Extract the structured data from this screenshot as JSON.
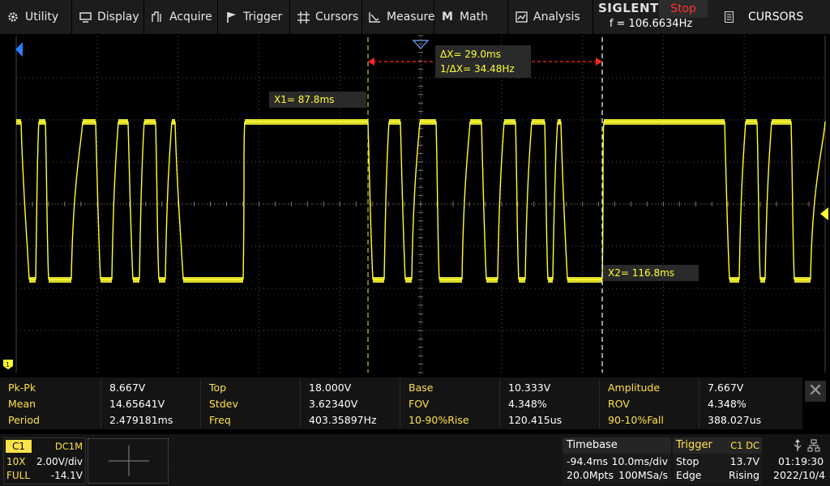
{
  "menu": [
    {
      "label": "Utility",
      "icon": "gear-icon"
    },
    {
      "label": "Display",
      "icon": "monitor-icon"
    },
    {
      "label": "Acquire",
      "icon": "acquire-icon"
    },
    {
      "label": "Trigger",
      "icon": "flag-icon"
    },
    {
      "label": "Cursors",
      "icon": "cursors-icon"
    },
    {
      "label": "Measure",
      "icon": "measure-icon"
    },
    {
      "label": "Math",
      "icon": "math-icon"
    },
    {
      "label": "Analysis",
      "icon": "analysis-icon"
    }
  ],
  "brand": {
    "name": "SIGLENT",
    "status": "Stop",
    "freq": "f = 106.6634Hz"
  },
  "panel": {
    "label": "CURSORS",
    "icon": "document-icon"
  },
  "cursors": {
    "delta_x": "ΔX= 29.0ms",
    "inv_delta_x": "1/ΔX= 34.48Hz",
    "x1": "X1= 87.8ms",
    "x2": "X2= 116.8ms"
  },
  "measure": [
    [
      {
        "label": "Pk-Pk",
        "value": "8.667V"
      },
      {
        "label": "Top",
        "value": "18.000V"
      },
      {
        "label": "Base",
        "value": "10.333V"
      },
      {
        "label": "Amplitude",
        "value": "7.667V"
      }
    ],
    [
      {
        "label": "Mean",
        "value": "14.65641V"
      },
      {
        "label": "Stdev",
        "value": "3.62340V"
      },
      {
        "label": "FOV",
        "value": "4.348%"
      },
      {
        "label": "ROV",
        "value": "4.348%"
      }
    ],
    [
      {
        "label": "Period",
        "value": "2.479181ms"
      },
      {
        "label": "Freq",
        "value": "403.35897Hz"
      },
      {
        "label": "10-90%Rise",
        "value": "120.415us"
      },
      {
        "label": "90-10%Fall",
        "value": "388.027us"
      }
    ]
  ],
  "channel": {
    "name": "C1",
    "coupling": "DC1M",
    "probe": "10X",
    "scale": "2.00V/div",
    "bandwidth": "FULL",
    "offset": "-14.1V"
  },
  "timebase": {
    "title": "Timebase",
    "delay": "-94.4ms",
    "scale": "10.0ms/div",
    "points": "20.0Mpts",
    "rate": "100MSa/s"
  },
  "trigger": {
    "title": "Trigger",
    "source": "C1 DC",
    "state": "Stop",
    "level": "13.7V",
    "type": "Edge",
    "slope": "Rising"
  },
  "clock": {
    "time": "01:19:30",
    "date": "2022/10/4"
  },
  "colors": {
    "trace": "#ffff33",
    "label": "#ffe24a",
    "stop": "#ff3333",
    "cursor_delta": "#ff2222"
  }
}
